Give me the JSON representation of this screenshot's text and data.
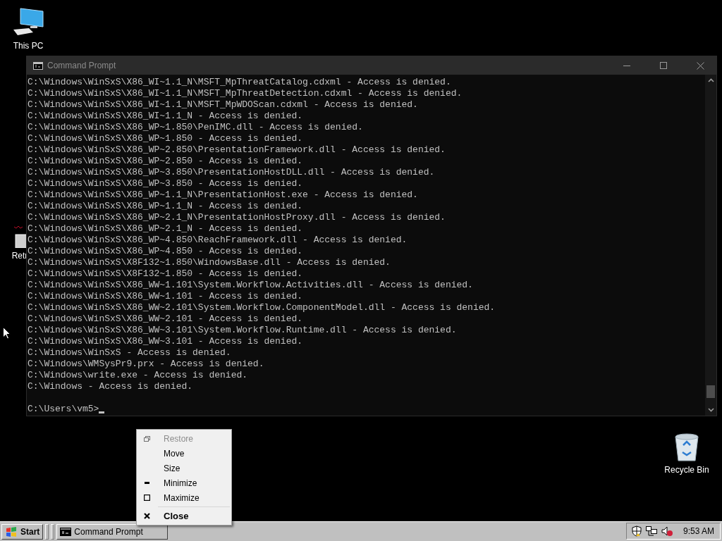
{
  "desktop_icons": [
    {
      "label": "This PC",
      "kind": "computer"
    },
    {
      "label": "Retr",
      "kind": "broken"
    },
    {
      "label": "Recycle Bin",
      "kind": "recycle"
    }
  ],
  "window": {
    "title": "Command Prompt",
    "lines": [
      "C:\\Windows\\WinSxS\\X86_WI~1.1_N\\MSFT_MpThreatCatalog.cdxml - Access is denied.",
      "C:\\Windows\\WinSxS\\X86_WI~1.1_N\\MSFT_MpThreatDetection.cdxml - Access is denied.",
      "C:\\Windows\\WinSxS\\X86_WI~1.1_N\\MSFT_MpWDOScan.cdxml - Access is denied.",
      "C:\\Windows\\WinSxS\\X86_WI~1.1_N - Access is denied.",
      "C:\\Windows\\WinSxS\\X86_WP~1.850\\PenIMC.dll - Access is denied.",
      "C:\\Windows\\WinSxS\\X86_WP~1.850 - Access is denied.",
      "C:\\Windows\\WinSxS\\X86_WP~2.850\\PresentationFramework.dll - Access is denied.",
      "C:\\Windows\\WinSxS\\X86_WP~2.850 - Access is denied.",
      "C:\\Windows\\WinSxS\\X86_WP~3.850\\PresentationHostDLL.dll - Access is denied.",
      "C:\\Windows\\WinSxS\\X86_WP~3.850 - Access is denied.",
      "C:\\Windows\\WinSxS\\X86_WP~1.1_N\\PresentationHost.exe - Access is denied.",
      "C:\\Windows\\WinSxS\\X86_WP~1.1_N - Access is denied.",
      "C:\\Windows\\WinSxS\\X86_WP~2.1_N\\PresentationHostProxy.dll - Access is denied.",
      "C:\\Windows\\WinSxS\\X86_WP~2.1_N - Access is denied.",
      "C:\\Windows\\WinSxS\\X86_WP~4.850\\ReachFramework.dll - Access is denied.",
      "C:\\Windows\\WinSxS\\X86_WP~4.850 - Access is denied.",
      "C:\\Windows\\WinSxS\\X8F132~1.850\\WindowsBase.dll - Access is denied.",
      "C:\\Windows\\WinSxS\\X8F132~1.850 - Access is denied.",
      "C:\\Windows\\WinSxS\\X86_WW~1.101\\System.Workflow.Activities.dll - Access is denied.",
      "C:\\Windows\\WinSxS\\X86_WW~1.101 - Access is denied.",
      "C:\\Windows\\WinSxS\\X86_WW~2.101\\System.Workflow.ComponentModel.dll - Access is denied.",
      "C:\\Windows\\WinSxS\\X86_WW~2.101 - Access is denied.",
      "C:\\Windows\\WinSxS\\X86_WW~3.101\\System.Workflow.Runtime.dll - Access is denied.",
      "C:\\Windows\\WinSxS\\X86_WW~3.101 - Access is denied.",
      "C:\\Windows\\WinSxS - Access is denied.",
      "C:\\Windows\\WMSysPr9.prx - Access is denied.",
      "C:\\Windows\\write.exe - Access is denied.",
      "C:\\Windows - Access is denied."
    ],
    "prompt": "C:\\Users\\vm5>"
  },
  "context_menu": [
    {
      "label": "Restore",
      "kind": "restore",
      "disabled": true,
      "default": false,
      "separator_before": false
    },
    {
      "label": "Move",
      "kind": "none",
      "disabled": false,
      "default": false,
      "separator_before": false
    },
    {
      "label": "Size",
      "kind": "none",
      "disabled": false,
      "default": false,
      "separator_before": false
    },
    {
      "label": "Minimize",
      "kind": "minimize",
      "disabled": false,
      "default": false,
      "separator_before": false
    },
    {
      "label": "Maximize",
      "kind": "maximize",
      "disabled": false,
      "default": false,
      "separator_before": false
    },
    {
      "label": "Close",
      "kind": "close",
      "disabled": false,
      "default": true,
      "separator_before": true
    }
  ],
  "taskbar": {
    "start": "Start",
    "tasks": [
      {
        "label": "Command Prompt",
        "selected": false
      }
    ],
    "clock": "9:53 AM"
  }
}
